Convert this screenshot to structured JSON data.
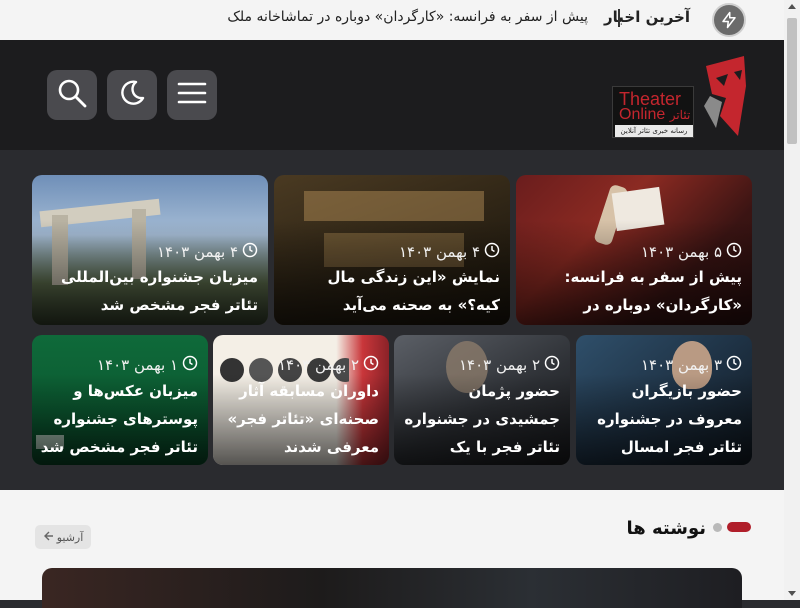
{
  "ticker": {
    "label": "آخرین اخبار",
    "text": "پیش از سفر به فرانسه: «کارگردان» دوباره در تماشاخانه ملک",
    "icon": "bolt-icon"
  },
  "header": {
    "logo": {
      "title_en": "Theater",
      "title_en2": "Online",
      "title_fa": "تئاتر",
      "tagline": "رسانه خبری تئاتر آنلاین"
    },
    "buttons": {
      "menu": "menu-icon",
      "theme": "moon-icon",
      "search": "search-icon"
    }
  },
  "cards_top": [
    {
      "date": "۵ بهمن ۱۴۰۳",
      "title": "پیش از سفر به فرانسه: «کارگردان» دوباره در تماشاخانه ملک"
    },
    {
      "date": "۴ بهمن ۱۴۰۳",
      "title": "نمایش «این زندگی مال کیه؟» به صحنه می‌آید"
    },
    {
      "date": "۴ بهمن ۱۴۰۳",
      "title": "میزبان جشنواره بین‌المللی تئاتر فجر مشخص شد"
    }
  ],
  "cards_bottom": [
    {
      "date": "۳ بهمن ۱۴۰۳",
      "title": "حضور بازیگران معروف در جشنواره تئاتر فجر امسال"
    },
    {
      "date": "۲ بهمن ۱۴۰۳",
      "title": "حضور پژمان جمشیدی در جشنواره تئاتر فجر با یک نمایش"
    },
    {
      "date": "۲ بهمن ۱۴۰۳",
      "title": "داوران مسابقه آثار صحنه‌ای «تئاتر فجر» معرفی شدند"
    },
    {
      "date": "۱ بهمن ۱۴۰۳",
      "title": "میزبان عکس‌ها و پوسترهای جشنواره تئاتر فجر مشخص شد"
    }
  ],
  "section": {
    "title": "نوشته ها",
    "archive_label": "آرشیو"
  },
  "colors": {
    "accent": "#b01e2a",
    "header_bg": "#1c1c1e",
    "body_bg": "#2a2b2f"
  }
}
